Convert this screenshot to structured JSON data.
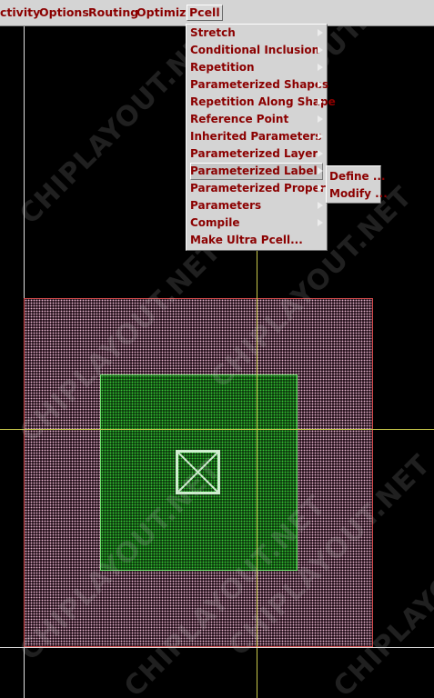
{
  "menubar": {
    "items": [
      "ctivity",
      "Options",
      "Routing",
      "Optimize",
      "Pcell"
    ],
    "active": "Pcell"
  },
  "pcell_menu": {
    "items": [
      {
        "label": "Stretch",
        "submenu": true
      },
      {
        "label": "Conditional Inclusion",
        "submenu": true
      },
      {
        "label": "Repetition",
        "submenu": true
      },
      {
        "label": "Parameterized Shapes",
        "submenu": true
      },
      {
        "label": "Repetition Along Shape",
        "submenu": true
      },
      {
        "label": "Reference Point",
        "submenu": true
      },
      {
        "label": "Inherited Parameters",
        "submenu": true
      },
      {
        "label": "Parameterized Layer",
        "submenu": true
      },
      {
        "label": "Parameterized Label",
        "submenu": true,
        "highlighted": true
      },
      {
        "label": "Parameterized Property",
        "submenu": true
      },
      {
        "label": "Parameters",
        "submenu": true
      },
      {
        "label": "Compile",
        "submenu": true
      },
      {
        "label": "Make Ultra Pcell...",
        "submenu": false
      }
    ]
  },
  "submenu": {
    "items": [
      "Define ...",
      "Modify ..."
    ]
  },
  "watermark": "CHIPLAYOUT.NET",
  "colors": {
    "menu_bg": "#d4d4d4",
    "menu_text": "#8b0000",
    "canvas_bg": "#000000",
    "axis_yellow": "#c8c84a",
    "grid_white": "#e0e0e0",
    "pink_fill": "#e7b6cf",
    "pink_border": "#d04a4a",
    "green_fill": "#37c837",
    "green_border": "#6ee06e",
    "contact": "#cfeecf"
  }
}
